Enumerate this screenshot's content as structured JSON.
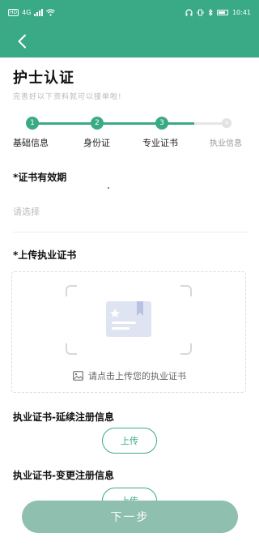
{
  "status_bar": {
    "left_badge": "HD",
    "network": "4G",
    "time": "10:41"
  },
  "header": {
    "back_icon": "chevron-left-icon",
    "accent_color": "#3aaa86"
  },
  "page": {
    "title": "护士认证",
    "subtitle": "完善好以下资料就可以接单啦!"
  },
  "steps": [
    {
      "number": "1",
      "label": "基础信息",
      "state": "done"
    },
    {
      "number": "2",
      "label": "身份证",
      "state": "done"
    },
    {
      "number": "3",
      "label": "专业证书",
      "state": "current"
    },
    {
      "number": "4",
      "label": "执业信息",
      "state": "todo"
    }
  ],
  "cert_validity": {
    "label": "*证书有效期",
    "placeholder": "请选择"
  },
  "upload": {
    "label": "*上传执业证书",
    "hint": "请点击上传您的执业证书",
    "icon": "image-icon"
  },
  "renewal": {
    "label": "执业证书-延续注册信息",
    "button": "上传"
  },
  "change": {
    "label": "执业证书-变更注册信息",
    "button": "上传"
  },
  "footer": {
    "next_button": "下一步"
  }
}
